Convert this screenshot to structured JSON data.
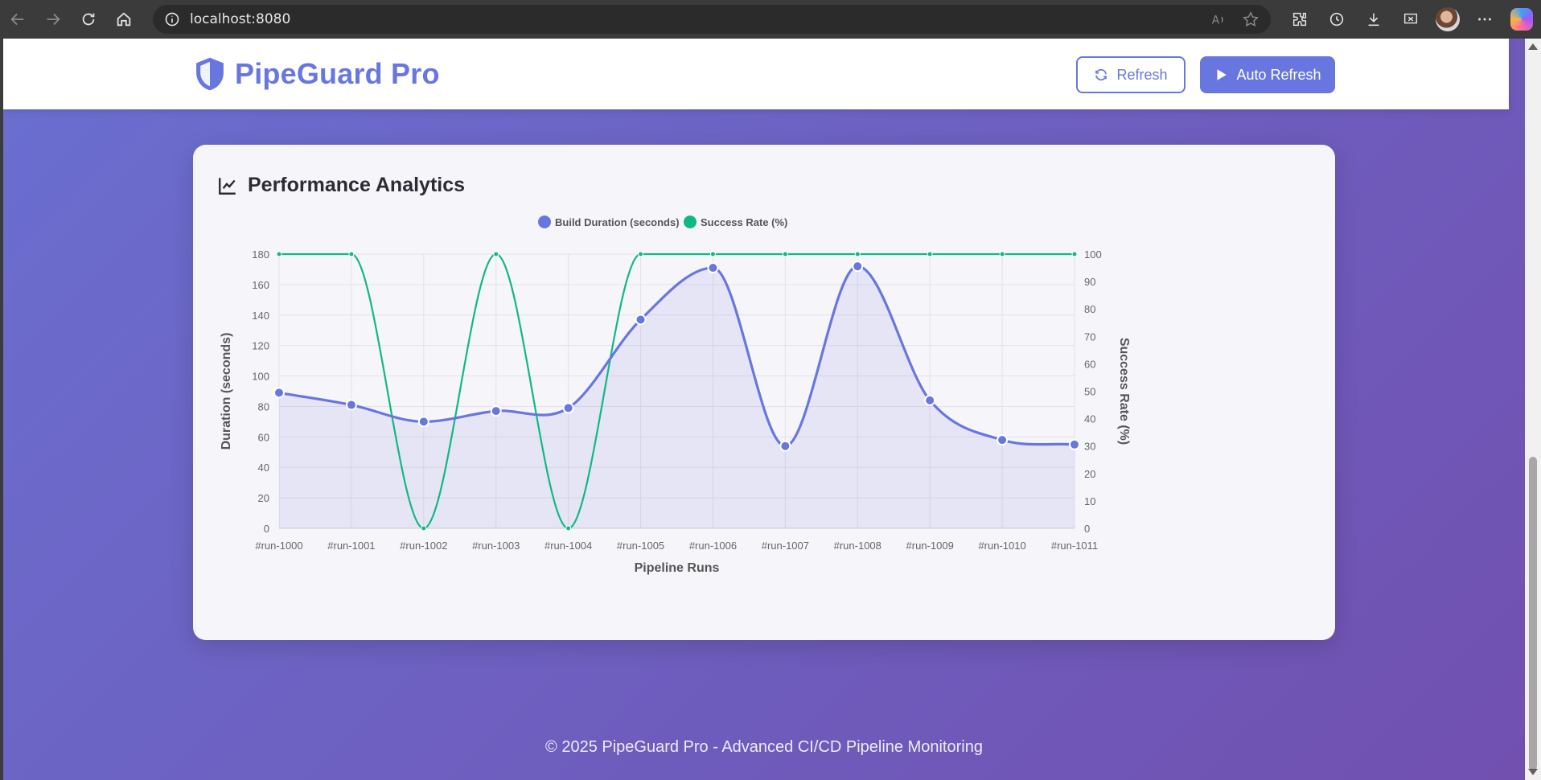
{
  "browser": {
    "url": "localhost:8080"
  },
  "header": {
    "brand": "PipeGuard Pro",
    "refresh_label": "Refresh",
    "auto_refresh_label": "Auto Refresh"
  },
  "analytics": {
    "title": "Performance Analytics"
  },
  "chart_data": {
    "type": "line",
    "categories": [
      "#run-1000",
      "#run-1001",
      "#run-1002",
      "#run-1003",
      "#run-1004",
      "#run-1005",
      "#run-1006",
      "#run-1007",
      "#run-1008",
      "#run-1009",
      "#run-1010",
      "#run-1011"
    ],
    "series": [
      {
        "name": "Build Duration (seconds)",
        "axis": "left",
        "color": "#6877df",
        "fill": true,
        "values": [
          89,
          81,
          70,
          77,
          79,
          137,
          171,
          54,
          172,
          84,
          58,
          55
        ]
      },
      {
        "name": "Success Rate (%)",
        "axis": "right",
        "color": "#10b981",
        "fill": false,
        "values": [
          100,
          100,
          0,
          100,
          0,
          100,
          100,
          100,
          100,
          100,
          100,
          100
        ]
      }
    ],
    "xlabel": "Pipeline Runs",
    "ylabel": "Duration (seconds)",
    "y2label": "Success Rate (%)",
    "ylim": [
      0,
      180
    ],
    "y2lim": [
      0,
      100
    ],
    "yticks": [
      0,
      20,
      40,
      60,
      80,
      100,
      120,
      140,
      160,
      180
    ],
    "y2ticks": [
      0,
      10,
      20,
      30,
      40,
      50,
      60,
      70,
      80,
      90,
      100
    ],
    "legend": "top-center",
    "grid": true
  },
  "footer": {
    "text": "© 2025 PipeGuard Pro - Advanced CI/CD Pipeline Monitoring"
  }
}
